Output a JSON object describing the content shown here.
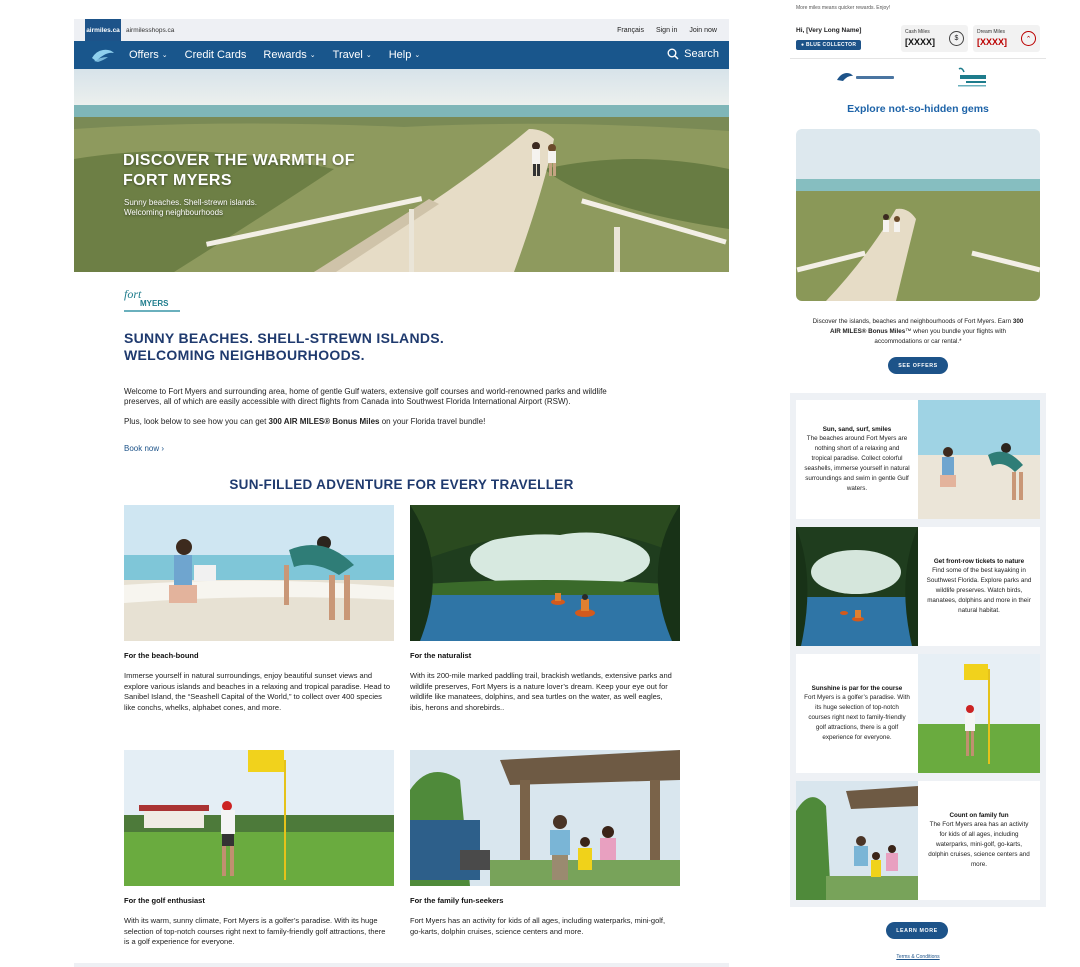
{
  "desktop": {
    "topbar": {
      "site_tab": "airmiles.ca",
      "site_tab2": "airmilesshops.ca",
      "links": [
        "Français",
        "Sign in",
        "Join now"
      ]
    },
    "nav": {
      "items": [
        "Offers",
        "Credit Cards",
        "Rewards",
        "Travel",
        "Help"
      ],
      "search": "Search"
    },
    "hero": {
      "title": "DISCOVER THE WARMTH OF FORT MYERS",
      "subtitle": "Sunny beaches. Shell-strewn islands. Welcoming neighbourhoods"
    },
    "heading": "SUNNY BEACHES. SHELL-STREWN ISLANDS. WELCOMING NEIGHBOURHOODS.",
    "intro": "Welcome to Fort Myers and surrounding area, home of gentle Gulf waters, extensive golf courses and world-renowned parks and wildlife preserves, all of which are easily accessible with direct flights from Canada into Southwest Florida International Airport (RSW).",
    "plus_prefix": "Plus, look below to see how you can get ",
    "plus_bold": "300 AIR MILES® Bonus Miles",
    "plus_suffix": " on your Florida travel bundle!",
    "book_now": "Book now",
    "section_title": "SUN-FILLED ADVENTURE FOR EVERY TRAVELLER",
    "cards": [
      {
        "title": "For the beach-bound",
        "text": "Immerse yourself in natural surroundings, enjoy beautiful sunset views and explore various islands and beaches in a relaxing and tropical paradise. Head to Sanibel Island, the “Seashell Capital of the World,” to collect over 400 species like conchs, whelks, alphabet cones, and more."
      },
      {
        "title": "For the naturalist",
        "text": "With its 200-mile marked paddling trail, brackish wetlands, extensive parks and wildlife preserves, Fort Myers is a nature lover’s dream. Keep your eye out for wildlife like manatees, dolphins, and sea turtles on the water, as well eagles, ibis, herons and shorebirds.."
      },
      {
        "title": "For the golf enthusiast",
        "text": "With its warm, sunny climate, Fort Myers is a golfer’s paradise. With its huge selection of top-notch courses right next to family-friendly golf attractions, there is a golf experience for everyone."
      },
      {
        "title": "For the family fun-seekers",
        "text": "Fort Myers has an activity for kids of all ages, including waterparks, mini-golf, go-karts, dolphin cruises, science centers and more."
      }
    ]
  },
  "email": {
    "preheader": "More miles means quicker rewards. Enjoy!",
    "greeting": "Hi, [Very Long Name]",
    "badge": "BLUE COLLECTOR",
    "cash": {
      "label": "Cash Miles",
      "value": "[XXXX]",
      "icon": "$"
    },
    "dream": {
      "label": "Dream Miles",
      "value": "[XXXX]"
    },
    "heading": "Explore not-so-hidden gems",
    "body_1": "Discover the islands, beaches and neighbourhoods of Fort Myers. Earn ",
    "body_bold": "300 AIR MILES® Bonus Miles",
    "body_2": "™ when you bundle your flights with accommodations or car rental.*",
    "see_offers": "SEE OFFERS",
    "features": [
      {
        "title": "Sun, sand, surf, smiles",
        "text": "The beaches around Fort Myers are nothing short of a relaxing and tropical paradise. Collect colorful seashells, immerse yourself in natural surroundings and swim in gentle Gulf waters."
      },
      {
        "title": "Get front-row tickets to nature",
        "text": "Find some of the best kayaking in Southwest Florida. Explore parks and wildlife preserves. Watch birds, manatees, dolphins and more in their natural habitat."
      },
      {
        "title": "Sunshine is par for the course",
        "text": "Fort Myers is a golfer’s paradise. With its huge selection of top-notch courses right next to family-friendly golf attractions, there is a golf experience for everyone."
      },
      {
        "title": "Count on family fun",
        "text": "The Fort Myers area has an activity for kids of all ages, including waterparks, mini-golf, go-karts, dolphin cruises, science centers and more."
      }
    ],
    "learn_more": "LEARN MORE",
    "terms": "Terms & Conditions"
  },
  "colors": {
    "brand_blue": "#19568c",
    "heading_navy": "#1f3a6e",
    "dream_red": "#b00000"
  }
}
